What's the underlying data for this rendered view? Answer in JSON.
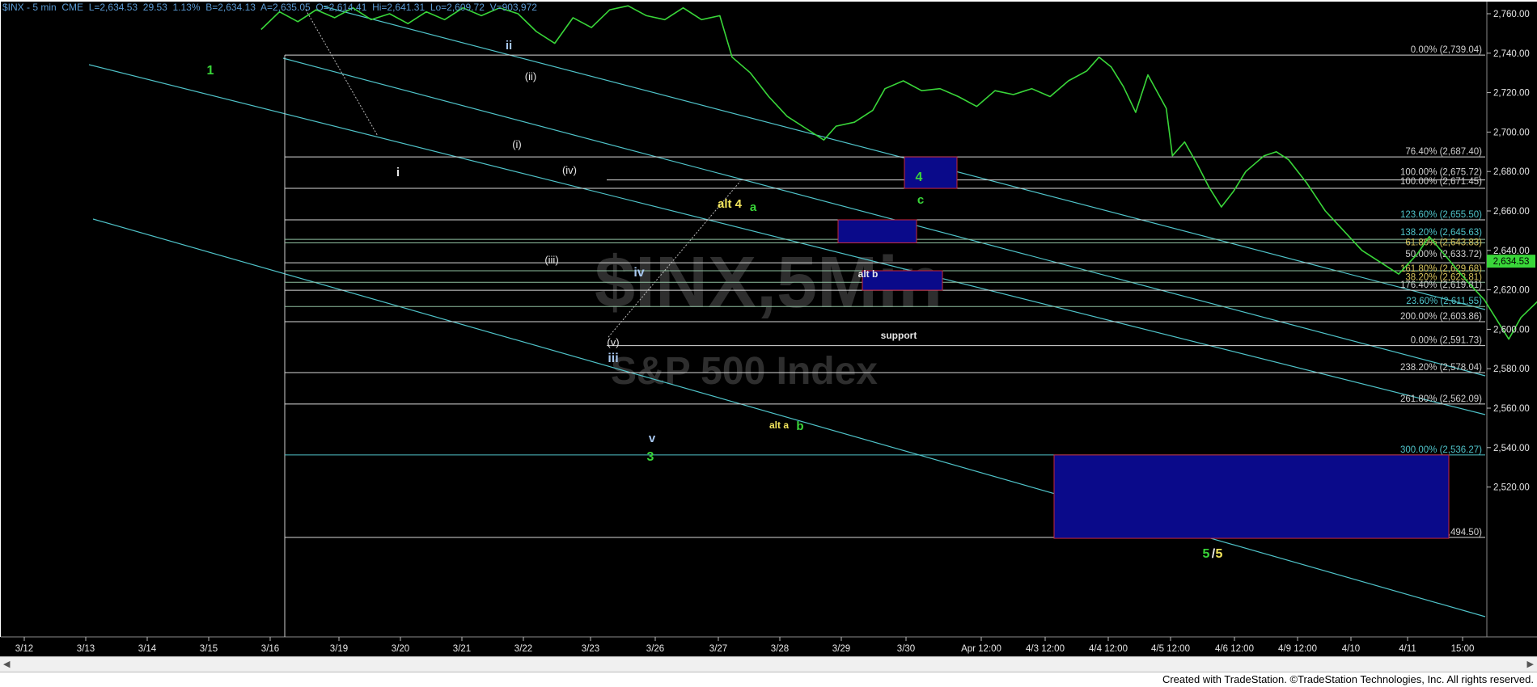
{
  "window": {
    "title": "$INX - 5 min",
    "header": {
      "symbol": "$INX - 5 min",
      "exchange": "CME",
      "last": "L=2,634.53",
      "change": "29.53",
      "change_pct": "1.13%",
      "bid": "B=2,634.13",
      "ask": "A=2,635.05",
      "open": "O=2,614.41",
      "high": "Hi=2,641.31",
      "low": "Lo=2,609.72",
      "volume": "V=903,972"
    },
    "watermark": {
      "line1": "$INX,5Min",
      "line2": "S&P 500 Index"
    },
    "footer": "Created with TradeStation. ©TradeStation Technologies, Inc. All rights reserved.",
    "last_price_tag": "2,634.53"
  },
  "colors": {
    "background": "#000000",
    "price_line": "#39d639",
    "channel": "#4fc3c9",
    "fib_lines": "#d9d9d9",
    "label_green": "#39d639",
    "label_yellow": "#f2e55c",
    "label_blue": "#a8c8f0",
    "label_white": "#e6e6e6",
    "box_fill": "#0a0a8a",
    "box_border": "#c8283c",
    "price_tag_bg": "#39d639"
  },
  "chart_data": {
    "type": "line",
    "title": "$INX - 5 min",
    "xlabel": "",
    "ylabel": "",
    "ylim": [
      2494,
      2767
    ],
    "y_ticks": [
      "2,760.00",
      "2,740.00",
      "2,720.00",
      "2,700.00",
      "2,680.00",
      "2,660.00",
      "2,640.00",
      "2,620.00",
      "2,600.00",
      "2,580.00",
      "2,560.00",
      "2,540.00",
      "2,520.00"
    ],
    "x_ticks": [
      "3/12",
      "3/13",
      "3/14",
      "3/15",
      "3/16",
      "3/19",
      "3/20",
      "3/21",
      "3/22",
      "3/23",
      "3/26",
      "3/27",
      "3/28",
      "3/29",
      "3/30",
      "Apr 12:00",
      "4/3 12:00",
      "4/4 12:00",
      "4/5 12:00",
      "4/6 12:00",
      "4/9 12:00",
      "4/10",
      "4/11",
      "15:00"
    ],
    "grid": false,
    "series": [
      {
        "values": [
          [
            3.9,
            2752
          ],
          [
            4.2,
            2761
          ],
          [
            4.5,
            2756
          ],
          [
            4.8,
            2762
          ],
          [
            5.1,
            2758
          ],
          [
            5.4,
            2763
          ],
          [
            5.7,
            2757
          ],
          [
            6.0,
            2760
          ],
          [
            6.3,
            2755
          ],
          [
            6.6,
            2761
          ],
          [
            6.9,
            2757
          ],
          [
            7.2,
            2763
          ],
          [
            7.5,
            2759
          ],
          [
            7.8,
            2763
          ],
          [
            8.1,
            2760
          ],
          [
            8.4,
            2751
          ],
          [
            8.7,
            2745
          ],
          [
            9.0,
            2758
          ],
          [
            9.3,
            2753
          ],
          [
            9.6,
            2762
          ],
          [
            9.9,
            2764
          ],
          [
            10.2,
            2759
          ],
          [
            10.5,
            2757
          ],
          [
            10.8,
            2763
          ],
          [
            11.1,
            2757
          ],
          [
            11.4,
            2759
          ],
          [
            11.6,
            2738
          ],
          [
            11.9,
            2730
          ],
          [
            12.2,
            2718
          ],
          [
            12.5,
            2708
          ],
          [
            12.8,
            2702
          ],
          [
            13.1,
            2696
          ],
          [
            13.3,
            2703
          ],
          [
            13.6,
            2705
          ],
          [
            13.9,
            2711
          ],
          [
            14.1,
            2722
          ],
          [
            14.4,
            2726
          ],
          [
            14.7,
            2721
          ],
          [
            15.0,
            2722
          ],
          [
            15.3,
            2718
          ],
          [
            15.6,
            2713
          ],
          [
            15.9,
            2721
          ],
          [
            16.2,
            2719
          ],
          [
            16.5,
            2722
          ],
          [
            16.8,
            2718
          ],
          [
            17.1,
            2726
          ],
          [
            17.4,
            2731
          ],
          [
            17.6,
            2738
          ],
          [
            17.8,
            2733
          ],
          [
            18.0,
            2723
          ],
          [
            18.2,
            2710
          ],
          [
            18.4,
            2729
          ],
          [
            18.7,
            2712
          ],
          [
            18.8,
            2688
          ],
          [
            19.0,
            2695
          ],
          [
            19.2,
            2684
          ],
          [
            19.4,
            2672
          ],
          [
            19.6,
            2662
          ],
          [
            19.8,
            2670
          ],
          [
            20.0,
            2680
          ],
          [
            20.3,
            2688
          ],
          [
            20.5,
            2690
          ],
          [
            20.7,
            2686
          ],
          [
            21.0,
            2674
          ],
          [
            21.3,
            2660
          ],
          [
            21.6,
            2650
          ],
          [
            21.9,
            2640
          ],
          [
            22.2,
            2634
          ],
          [
            22.5,
            2628
          ],
          [
            22.8,
            2638
          ],
          [
            23.0,
            2647
          ],
          [
            23.3,
            2636
          ],
          [
            23.6,
            2625
          ],
          [
            23.9,
            2615
          ],
          [
            24.1,
            2605
          ],
          [
            24.3,
            2595
          ],
          [
            24.5,
            2606
          ],
          [
            24.8,
            2615
          ],
          [
            25.0,
            2604
          ],
          [
            25.3,
            2615
          ],
          [
            25.6,
            2626
          ],
          [
            25.9,
            2632
          ],
          [
            26.2,
            2640
          ],
          [
            26.5,
            2650
          ],
          [
            26.8,
            2656
          ],
          [
            27.1,
            2664
          ],
          [
            27.4,
            2670
          ],
          [
            27.6,
            2675
          ],
          [
            27.9,
            2668
          ],
          [
            28.2,
            2658
          ],
          [
            28.4,
            2648
          ],
          [
            28.7,
            2636
          ],
          [
            28.9,
            2620
          ],
          [
            29.1,
            2603
          ],
          [
            29.3,
            2615
          ],
          [
            29.6,
            2609
          ],
          [
            29.9,
            2598
          ],
          [
            30.2,
            2612
          ],
          [
            30.4,
            2602
          ],
          [
            30.7,
            2616
          ],
          [
            30.9,
            2604
          ],
          [
            31.2,
            2612
          ],
          [
            31.5,
            2603
          ],
          [
            31.7,
            2599
          ],
          [
            32.0,
            2612
          ],
          [
            32.2,
            2618
          ],
          [
            32.5,
            2622
          ],
          [
            32.8,
            2615
          ],
          [
            33.0,
            2624
          ],
          [
            33.3,
            2640
          ],
          [
            33.6,
            2632
          ],
          [
            33.8,
            2636
          ],
          [
            34.0,
            2634.53
          ]
        ]
      }
    ],
    "fib_levels": [
      {
        "label": "0.00% (2,739.04)",
        "value": 2739.04
      },
      {
        "label": "76.40% (2,687.40)",
        "value": 2687.4
      },
      {
        "label": "100.00% (2,675.72)",
        "value": 2675.72
      },
      {
        "label": "100.00% (2,671.45)",
        "value": 2671.45
      },
      {
        "label": "123.60% (2,655.50)",
        "value": 2655.5
      },
      {
        "label": "138.20% (2,645.63)",
        "value": 2645.63
      },
      {
        "label": "61.80% (2,643.83)",
        "value": 2643.83
      },
      {
        "label": "50.00% (2,633.72)",
        "value": 2633.72
      },
      {
        "label": "161.80% (2,629.68)",
        "value": 2629.68
      },
      {
        "label": "38.20% (2,623.81)",
        "value": 2623.81
      },
      {
        "label": "176.40% (2,619.81)",
        "value": 2619.81
      },
      {
        "label": "23.60% (2,611.55)",
        "value": 2611.55
      },
      {
        "label": "200.00% (2,603.86)",
        "value": 2603.86
      },
      {
        "label": "0.00% (2,591.73)",
        "value": 2591.73
      },
      {
        "label": "238.20% (2,578.04)",
        "value": 2578.04
      },
      {
        "label": "261.80% (2,562.09)",
        "value": 2562.09
      },
      {
        "label": "300.00% (2,536.27)",
        "value": 2536.27
      },
      {
        "label": "361.80% (2,494.50)",
        "value": 2494.5
      }
    ],
    "wave_labels": [
      {
        "text": "1",
        "color": "label_green"
      },
      {
        "text": "i",
        "color": "label_white"
      },
      {
        "text": "ii",
        "color": "label_blue"
      },
      {
        "text": "(i)",
        "color": "label_white"
      },
      {
        "text": "(ii)",
        "color": "label_white"
      },
      {
        "text": "(iii)",
        "color": "label_white"
      },
      {
        "text": "(iv)",
        "color": "label_white"
      },
      {
        "text": "(v)",
        "color": "label_white"
      },
      {
        "text": "iii",
        "color": "label_blue"
      },
      {
        "text": "iv",
        "color": "label_blue"
      },
      {
        "text": "v",
        "color": "label_blue"
      },
      {
        "text": "3",
        "color": "label_green"
      },
      {
        "text": "alt 4",
        "color": "label_yellow"
      },
      {
        "text": "a",
        "color": "label_green"
      },
      {
        "text": "alt a",
        "color": "label_yellow"
      },
      {
        "text": "b",
        "color": "label_green"
      },
      {
        "text": "4",
        "color": "label_green"
      },
      {
        "text": "c",
        "color": "label_green"
      },
      {
        "text": "alt b",
        "color": "label_white"
      },
      {
        "text": "support",
        "color": "label_white"
      },
      {
        "text": "5",
        "color": "label_green"
      },
      {
        "text": "/",
        "color": "label_white"
      },
      {
        "text": "5",
        "color": "label_yellow"
      }
    ]
  }
}
